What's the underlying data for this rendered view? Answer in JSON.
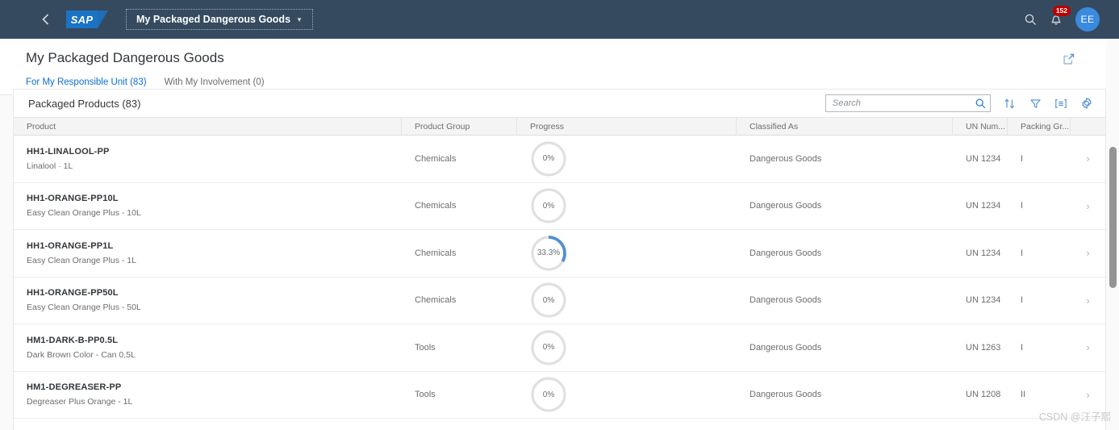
{
  "shellbar": {
    "back_icon": "chevron-left-icon",
    "logo_text": "SAP",
    "app_title": "My Packaged Dangerous Goods",
    "caret": "▼",
    "search_icon": "search-icon",
    "notifications_icon": "bell-icon",
    "notifications_count": "152",
    "avatar_initials": "EE",
    "bg_color": "#354a5f"
  },
  "page": {
    "title": "My Packaged Dangerous Goods",
    "share_icon": "share-export-icon",
    "tabs": [
      {
        "label": "For My Responsible Unit (83)",
        "active": true
      },
      {
        "label": "With My Involvement (0)",
        "active": false
      }
    ]
  },
  "toolbar": {
    "title": "Packaged Products (83)",
    "search_placeholder": "Search",
    "search_value": "",
    "search_icon": "search-icon",
    "sort_icon": "sort-icon",
    "filter_icon": "filter-icon",
    "group_icon": "group-icon",
    "settings_icon": "gear-icon"
  },
  "table": {
    "columns": [
      "Product",
      "Product Group",
      "Progress",
      "Classified As",
      "UN Num...",
      "Packing Gr..."
    ],
    "rows": [
      {
        "product_id": "HH1-LINALOOL-PP",
        "product_desc": "Linalool · 1L",
        "product_group": "Chemicals",
        "progress_label": "0%",
        "progress_value": 0,
        "classified_as": "Dangerous Goods",
        "un_number": "UN 1234",
        "packing_group": "I",
        "nav_icon": "chevron-right-icon"
      },
      {
        "product_id": "HH1-ORANGE-PP10L",
        "product_desc": "Easy Clean Orange Plus - 10L",
        "product_group": "Chemicals",
        "progress_label": "0%",
        "progress_value": 0,
        "classified_as": "Dangerous Goods",
        "un_number": "UN 1234",
        "packing_group": "I",
        "nav_icon": "chevron-right-icon"
      },
      {
        "product_id": "HH1-ORANGE-PP1L",
        "product_desc": "Easy Clean Orange Plus - 1L",
        "product_group": "Chemicals",
        "progress_label": "33.3%",
        "progress_value": 33.3,
        "classified_as": "Dangerous Goods",
        "un_number": "UN 1234",
        "packing_group": "I",
        "nav_icon": "chevron-right-icon"
      },
      {
        "product_id": "HH1-ORANGE-PP50L",
        "product_desc": "Easy Clean Orange Plus - 50L",
        "product_group": "Chemicals",
        "progress_label": "0%",
        "progress_value": 0,
        "classified_as": "Dangerous Goods",
        "un_number": "UN 1234",
        "packing_group": "I",
        "nav_icon": "chevron-right-icon"
      },
      {
        "product_id": "HM1-DARK-B-PP0.5L",
        "product_desc": "Dark Brown Color - Can 0,5L",
        "product_group": "Tools",
        "progress_label": "0%",
        "progress_value": 0,
        "classified_as": "Dangerous Goods",
        "un_number": "UN 1263",
        "packing_group": "I",
        "nav_icon": "chevron-right-icon"
      },
      {
        "product_id": "HM1-DEGREASER-PP",
        "product_desc": "Degreaser Plus Orange - 1L",
        "product_group": "Tools",
        "progress_label": "0%",
        "progress_value": 0,
        "classified_as": "Dangerous Goods",
        "un_number": "UN 1208",
        "packing_group": "II",
        "nav_icon": "chevron-right-icon"
      }
    ]
  },
  "colors": {
    "accent": "#0a6ed1",
    "progress_arc": "#4f8fd1",
    "progress_track": "#e0e0e0",
    "badge": "#bb0000"
  },
  "watermark": "CSDN @汪子熙"
}
